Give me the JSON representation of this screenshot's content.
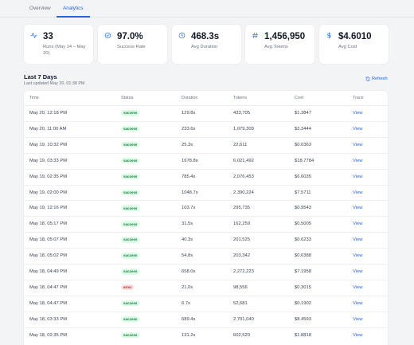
{
  "tabs": [
    {
      "label": "Overview"
    },
    {
      "label": "Analytics"
    }
  ],
  "stats": [
    {
      "icon": "activity-icon",
      "value": "33",
      "label": "Runs (May 14 – May 20)"
    },
    {
      "icon": "check-circle-icon",
      "value": "97.0%",
      "label": "Success Rate"
    },
    {
      "icon": "clock-icon",
      "value": "468.3s",
      "label": "Avg Duration"
    },
    {
      "icon": "hash-icon",
      "value": "1,456,950",
      "label": "Avg Tokens"
    },
    {
      "icon": "dollar-icon",
      "value": "$4.6010",
      "label": "Avg Cost"
    }
  ],
  "section": {
    "title": "Last 7 Days",
    "subtitle": "Last updated May 20, 01:38 PM",
    "refresh_label": "Refresh"
  },
  "table": {
    "headers": [
      "Time",
      "Status",
      "Duration",
      "Tokens",
      "Cost",
      "Trace"
    ],
    "rows": [
      {
        "time": "May 20, 12:18 PM",
        "status": "success",
        "duration": "129.8s",
        "tokens": "433,705",
        "cost": "$1.3847",
        "trace": "View"
      },
      {
        "time": "May 20, 11:00 AM",
        "status": "success",
        "duration": "233.6s",
        "tokens": "1,079,309",
        "cost": "$3.3444",
        "trace": "View"
      },
      {
        "time": "May 19, 10:32 PM",
        "status": "success",
        "duration": "25.3s",
        "tokens": "22,611",
        "cost": "$0.0363",
        "trace": "View"
      },
      {
        "time": "May 19, 03:33 PM",
        "status": "success",
        "duration": "1678.8s",
        "tokens": "6,021,492",
        "cost": "$18.7784",
        "trace": "View"
      },
      {
        "time": "May 19, 02:35 PM",
        "status": "success",
        "duration": "785.4s",
        "tokens": "2,076,453",
        "cost": "$6.6035",
        "trace": "View"
      },
      {
        "time": "May 19, 02:00 PM",
        "status": "success",
        "duration": "1048.7s",
        "tokens": "2,390,224",
        "cost": "$7.5711",
        "trace": "View"
      },
      {
        "time": "May 19, 12:16 PM",
        "status": "success",
        "duration": "103.7s",
        "tokens": "295,735",
        "cost": "$0.9543",
        "trace": "View"
      },
      {
        "time": "May 18, 05:17 PM",
        "status": "success",
        "duration": "31.5s",
        "tokens": "162,259",
        "cost": "$0.5005",
        "trace": "View"
      },
      {
        "time": "May 18, 05:07 PM",
        "status": "success",
        "duration": "40.3s",
        "tokens": "201,525",
        "cost": "$0.6233",
        "trace": "View"
      },
      {
        "time": "May 18, 05:02 PM",
        "status": "success",
        "duration": "54.8s",
        "tokens": "203,342",
        "cost": "$0.6388",
        "trace": "View"
      },
      {
        "time": "May 18, 04:49 PM",
        "status": "success",
        "duration": "658.0s",
        "tokens": "2,272,223",
        "cost": "$7.1958",
        "trace": "View"
      },
      {
        "time": "May 18, 04:47 PM",
        "status": "error",
        "duration": "21.0s",
        "tokens": "98,556",
        "cost": "$0.3015",
        "trace": "View"
      },
      {
        "time": "May 18, 04:47 PM",
        "status": "success",
        "duration": "6.7s",
        "tokens": "52,681",
        "cost": "$0.1902",
        "trace": "View"
      },
      {
        "time": "May 18, 03:33 PM",
        "status": "success",
        "duration": "689.4s",
        "tokens": "2,701,040",
        "cost": "$8.4593",
        "trace": "View"
      },
      {
        "time": "May 18, 02:35 PM",
        "status": "success",
        "duration": "131.2s",
        "tokens": "602,520",
        "cost": "$1.8818",
        "trace": "View"
      }
    ]
  }
}
